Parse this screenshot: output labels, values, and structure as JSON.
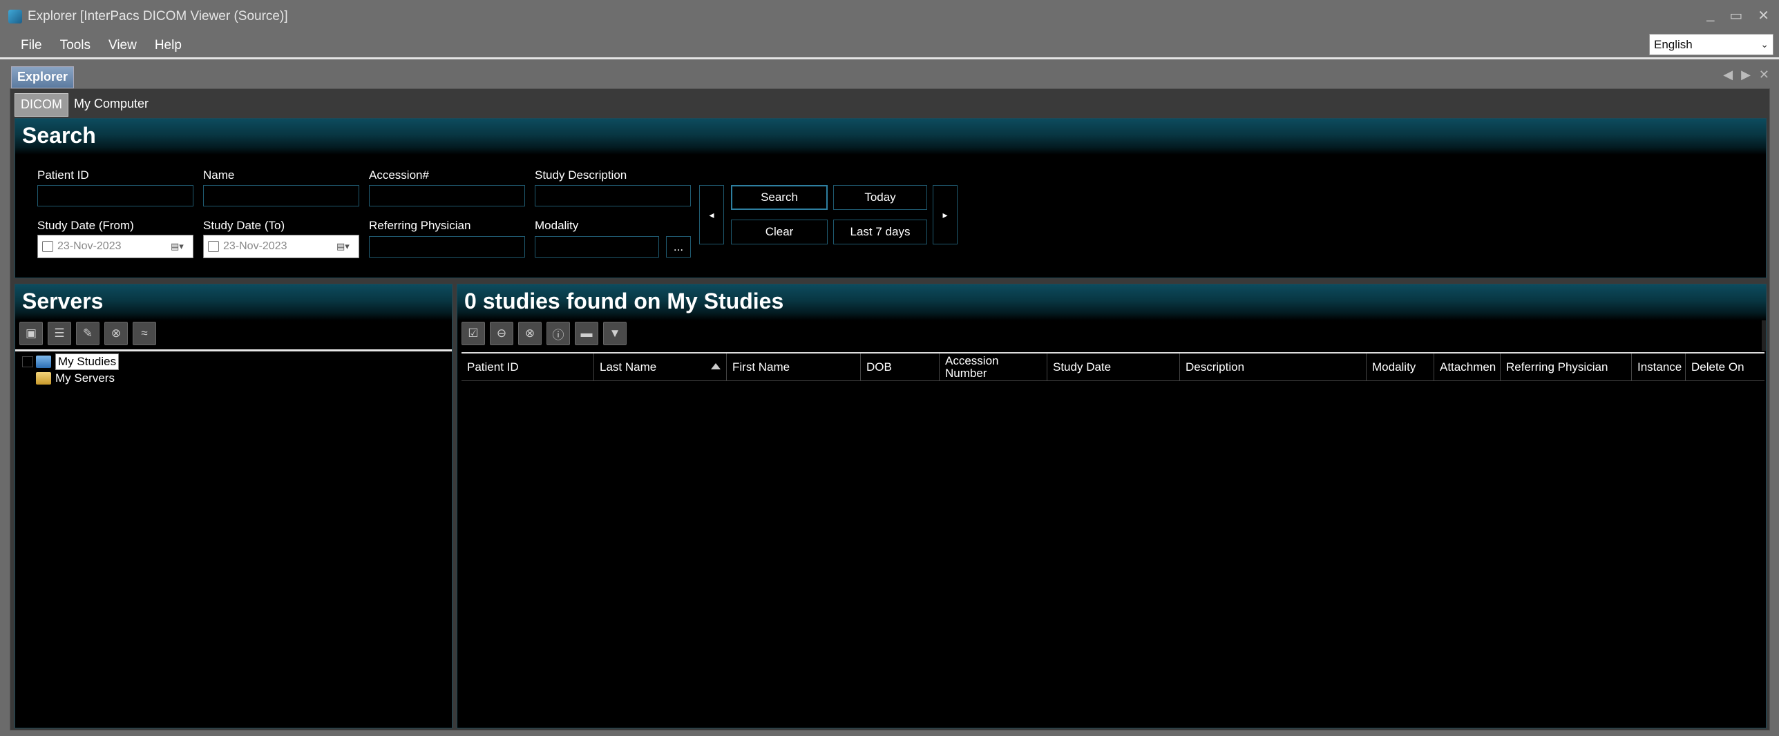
{
  "window": {
    "title": "Explorer [InterPacs DICOM Viewer (Source)]",
    "controls": [
      "_",
      "▭",
      "✕"
    ]
  },
  "menu": {
    "items": [
      "File",
      "Tools",
      "View",
      "Help"
    ],
    "language": "English"
  },
  "doc_tab": {
    "label": "Explorer"
  },
  "subtabs": [
    "DICOM",
    "My Computer"
  ],
  "search": {
    "header": "Search",
    "labels": {
      "patient_id": "Patient ID",
      "name": "Name",
      "accession": "Accession#",
      "study_description": "Study Description",
      "date_from": "Study Date (From)",
      "date_to": "Study Date (To)",
      "referring_physician": "Referring Physician",
      "modality": "Modality"
    },
    "date_from_value": "23-Nov-2023",
    "date_to_value": "23-Nov-2023",
    "modality_browse": "...",
    "buttons": {
      "search": "Search",
      "clear": "Clear",
      "today": "Today",
      "last7": "Last 7 days",
      "prev": "◂",
      "next": "▸"
    }
  },
  "servers": {
    "header": "Servers",
    "tree": [
      "My Studies",
      "My Servers"
    ]
  },
  "studies": {
    "header": "0 studies found on My Studies",
    "columns": [
      "Patient ID",
      "Last Name",
      "First Name",
      "DOB",
      "Accession Number",
      "Study Date",
      "Description",
      "Modality",
      "Attachmen",
      "Referring Physician",
      "Instance",
      "Delete On"
    ]
  }
}
